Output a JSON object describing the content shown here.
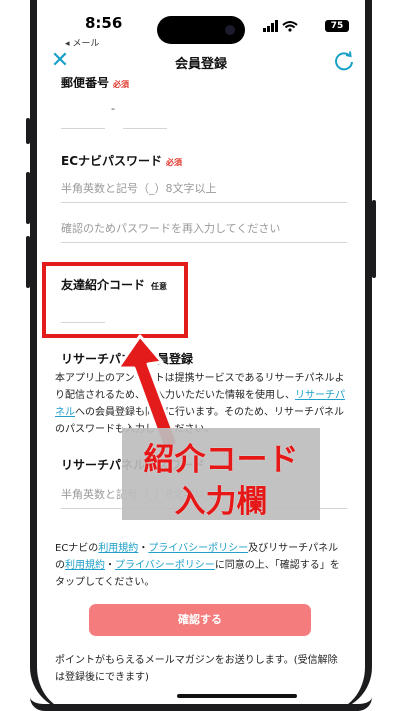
{
  "status_bar": {
    "time": "8:56",
    "back_app": "◂ メール",
    "battery": "75"
  },
  "nav": {
    "title": "会員登録",
    "close_icon": "close-icon",
    "refresh_icon": "refresh-icon"
  },
  "postal": {
    "label": "郵便番号",
    "required": "必須",
    "separator": "-"
  },
  "password": {
    "label": "ECナビパスワード",
    "required": "必須",
    "placeholder": "半角英数と記号（_）8文字以上",
    "confirm_placeholder": "確認のためパスワードを再入力してください"
  },
  "referral": {
    "label": "友達紹介コード",
    "optional": "任意",
    "value": ""
  },
  "research": {
    "label": "リサーチパネル会員登録",
    "desc_1": "本アプリ上のアンケートは提携サービスであるリサーチパネルより配信されるため、ご入力いただいた情報を使用し、",
    "desc_link": "リサーチパネル",
    "desc_2": "への会員登録も同時に行います。そのため、リサーチパネルのパスワードも入力してください。",
    "password_label": "リサーチパネルパスワード",
    "password_placeholder": "半角英数と記号（_）8文字以上"
  },
  "terms": {
    "t1": "ECナビの",
    "link1": "利用規約",
    "t2": "・",
    "link2": "プライバシーポリシー",
    "t3": "及びリサーチパネルの",
    "link3": "利用規約",
    "t4": "・",
    "link4": "プライバシーポリシー",
    "t5": "に同意の上、「確認する」をタップしてください。"
  },
  "confirm_button": "確認する",
  "newsletter": "ポイントがもらえるメールマガジンをお送りします。(受信解除は登録後にできます)",
  "overlay": {
    "line1": "紹介コード",
    "line2": "入力欄"
  },
  "colors": {
    "accent": "#19a0c8",
    "button": "#f47c7c",
    "highlight": "#e31b1b",
    "required": "#e0372c"
  }
}
